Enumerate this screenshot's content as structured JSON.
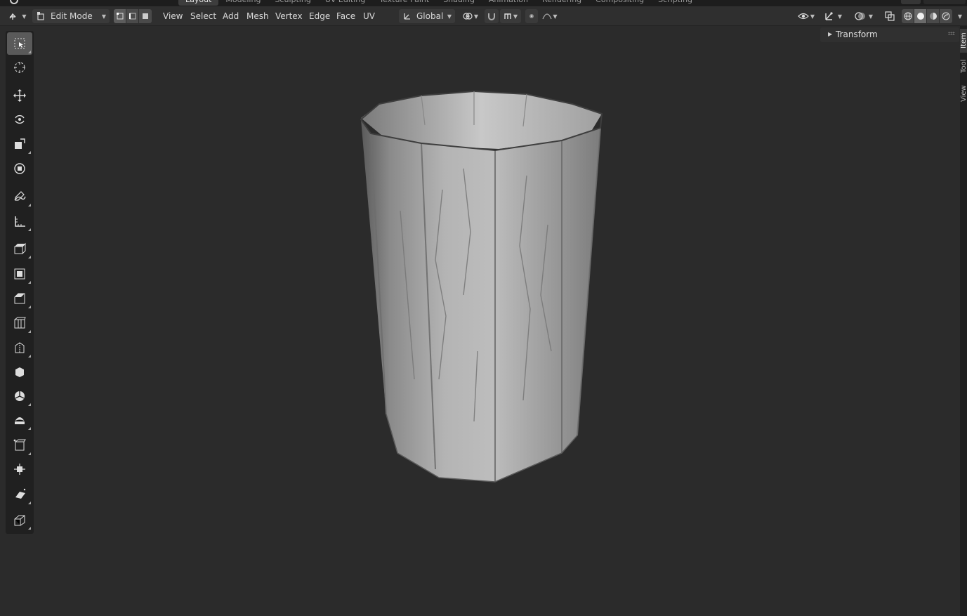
{
  "workspace_tabs": [
    "Layout",
    "Modeling",
    "Sculpting",
    "UV Editing",
    "Texture Paint",
    "Shading",
    "Animation",
    "Rendering",
    "Compositing",
    "Scripting"
  ],
  "active_workspace": "Layout",
  "header": {
    "mode_label": "Edit Mode",
    "menus": [
      "View",
      "Select",
      "Add",
      "Mesh",
      "Vertex",
      "Edge",
      "Face",
      "UV"
    ],
    "transform_orientation": "Global"
  },
  "tools": [
    "select-box-tool",
    "cursor-tool",
    "move-tool",
    "rotate-tool",
    "scale-tool",
    "transform-tool",
    "annotate-tool",
    "measure-tool",
    "extrude-region-tool",
    "inset-faces-tool",
    "bevel-tool",
    "loop-cut-tool",
    "knife-tool",
    "poly-build-tool",
    "spin-tool",
    "smooth-tool",
    "edge-slide-tool",
    "shrink-fatten-tool",
    "shear-tool",
    "rip-region-tool"
  ],
  "active_tool": "select-box-tool",
  "npanel": {
    "transform_label": "Transform"
  },
  "sidebar_tabs": [
    "Item",
    "Tool",
    "View"
  ],
  "colors": {
    "background": "#2b2b2b",
    "toolbar": "#202020",
    "active_tool": "#5a5a5a",
    "mesh_base": "#9a9a9a"
  }
}
